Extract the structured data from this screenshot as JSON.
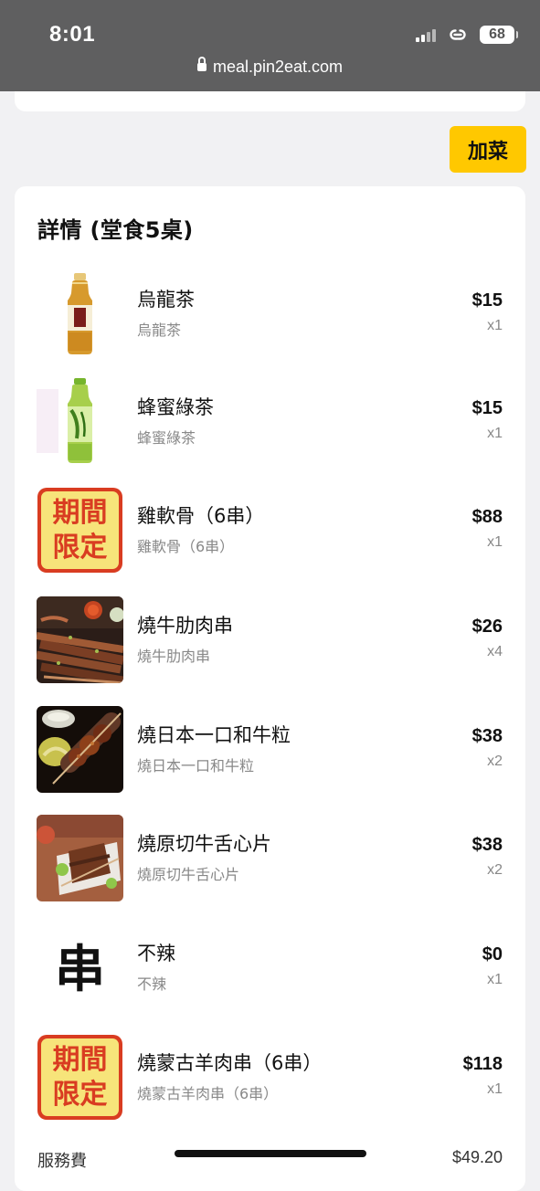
{
  "status_bar": {
    "time": "8:01",
    "battery": "68"
  },
  "browser": {
    "url": "meal.pin2eat.com"
  },
  "actions": {
    "add_dish": "加菜"
  },
  "details": {
    "title": "詳情 (堂食5桌)",
    "items": [
      {
        "name": "烏龍茶",
        "subtitle": "烏龍茶",
        "price": "$15",
        "quantity": "x1",
        "image_icon": "oolong-tea-bottle-icon"
      },
      {
        "name": "蜂蜜綠茶",
        "subtitle": "蜂蜜綠茶",
        "price": "$15",
        "quantity": "x1",
        "image_icon": "honey-green-tea-bottle-icon"
      },
      {
        "name": "雞軟骨（6串）",
        "subtitle": "雞軟骨（6串）",
        "price": "$88",
        "quantity": "x1",
        "image_icon": "limited-time-badge-icon",
        "badge_text": "期間限定"
      },
      {
        "name": "燒牛肋肉串",
        "subtitle": "燒牛肋肉串",
        "price": "$26",
        "quantity": "x4",
        "image_icon": "beef-rib-skewers-photo"
      },
      {
        "name": "燒日本一口和牛粒",
        "subtitle": "燒日本一口和牛粒",
        "price": "$38",
        "quantity": "x2",
        "image_icon": "wagyu-cubes-skewer-photo"
      },
      {
        "name": "燒原切牛舌心片",
        "subtitle": "燒原切牛舌心片",
        "price": "$38",
        "quantity": "x2",
        "image_icon": "beef-tongue-skewer-photo"
      },
      {
        "name": "不辣",
        "subtitle": "不辣",
        "price": "$0",
        "quantity": "x1",
        "image_icon": "skewer-character-icon",
        "glyph": "串"
      },
      {
        "name": "燒蒙古羊肉串（6串）",
        "subtitle": "燒蒙古羊肉串（6串）",
        "price": "$118",
        "quantity": "x1",
        "image_icon": "limited-time-badge-icon",
        "badge_text": "期間限定"
      }
    ],
    "service_fee": {
      "label": "服務費",
      "value": "$49.20"
    }
  },
  "colors": {
    "status_bar": "#5f5f60",
    "background": "#f1f1f3",
    "accent_button": "#ffc800",
    "badge_red": "#d93c21",
    "badge_yellow": "#f7e47a"
  }
}
